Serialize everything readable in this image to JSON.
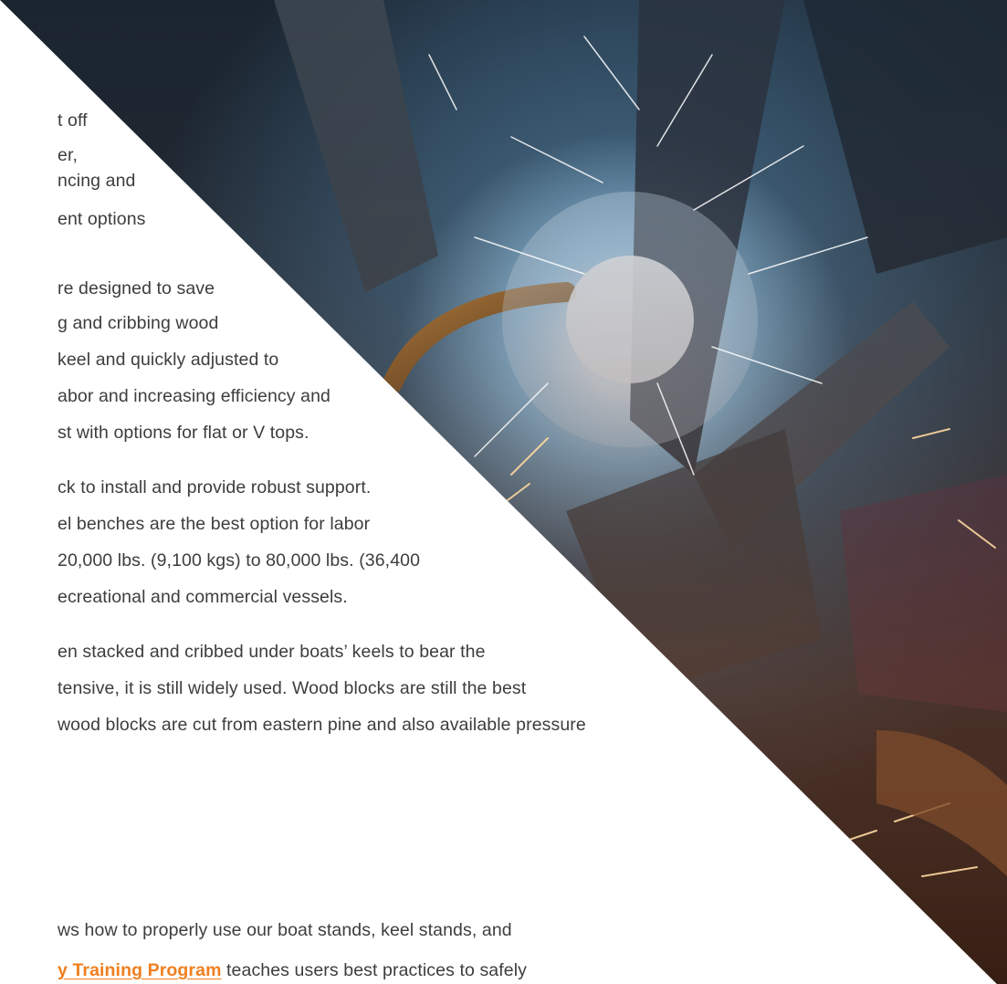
{
  "paragraph_1": {
    "lines": [
      "t off",
      "er,",
      "ncing and",
      "ent options"
    ]
  },
  "paragraph_2": {
    "lines": [
      "re designed to save",
      "g and cribbing wood",
      "keel and quickly adjusted to",
      "abor and increasing efficiency and",
      "st with options for flat or V tops."
    ]
  },
  "paragraph_3": {
    "lines": [
      "ck to install and provide robust support.",
      "el benches are the best option for labor",
      "20,000 lbs. (9,100 kgs) to 80,000 lbs. (36,400",
      "ecreational and commercial vessels."
    ]
  },
  "paragraph_4": {
    "lines": [
      "en stacked and cribbed under boats’ keels to bear the",
      "tensive, it is still widely used.  Wood blocks are still the best",
      "wood blocks are cut from eastern pine and also available pressure"
    ]
  },
  "paragraph_5": {
    "line_1": "ws how to properly use our boat stands, keel stands, and",
    "link_text": "y Training Program",
    "line_2_tail": " teaches users best practices to safely"
  },
  "image": {
    "subject": "welding-sparks-photo"
  },
  "colors": {
    "body_text": "#3d3d3d",
    "link": "#f07f1f",
    "background": "#ffffff"
  }
}
